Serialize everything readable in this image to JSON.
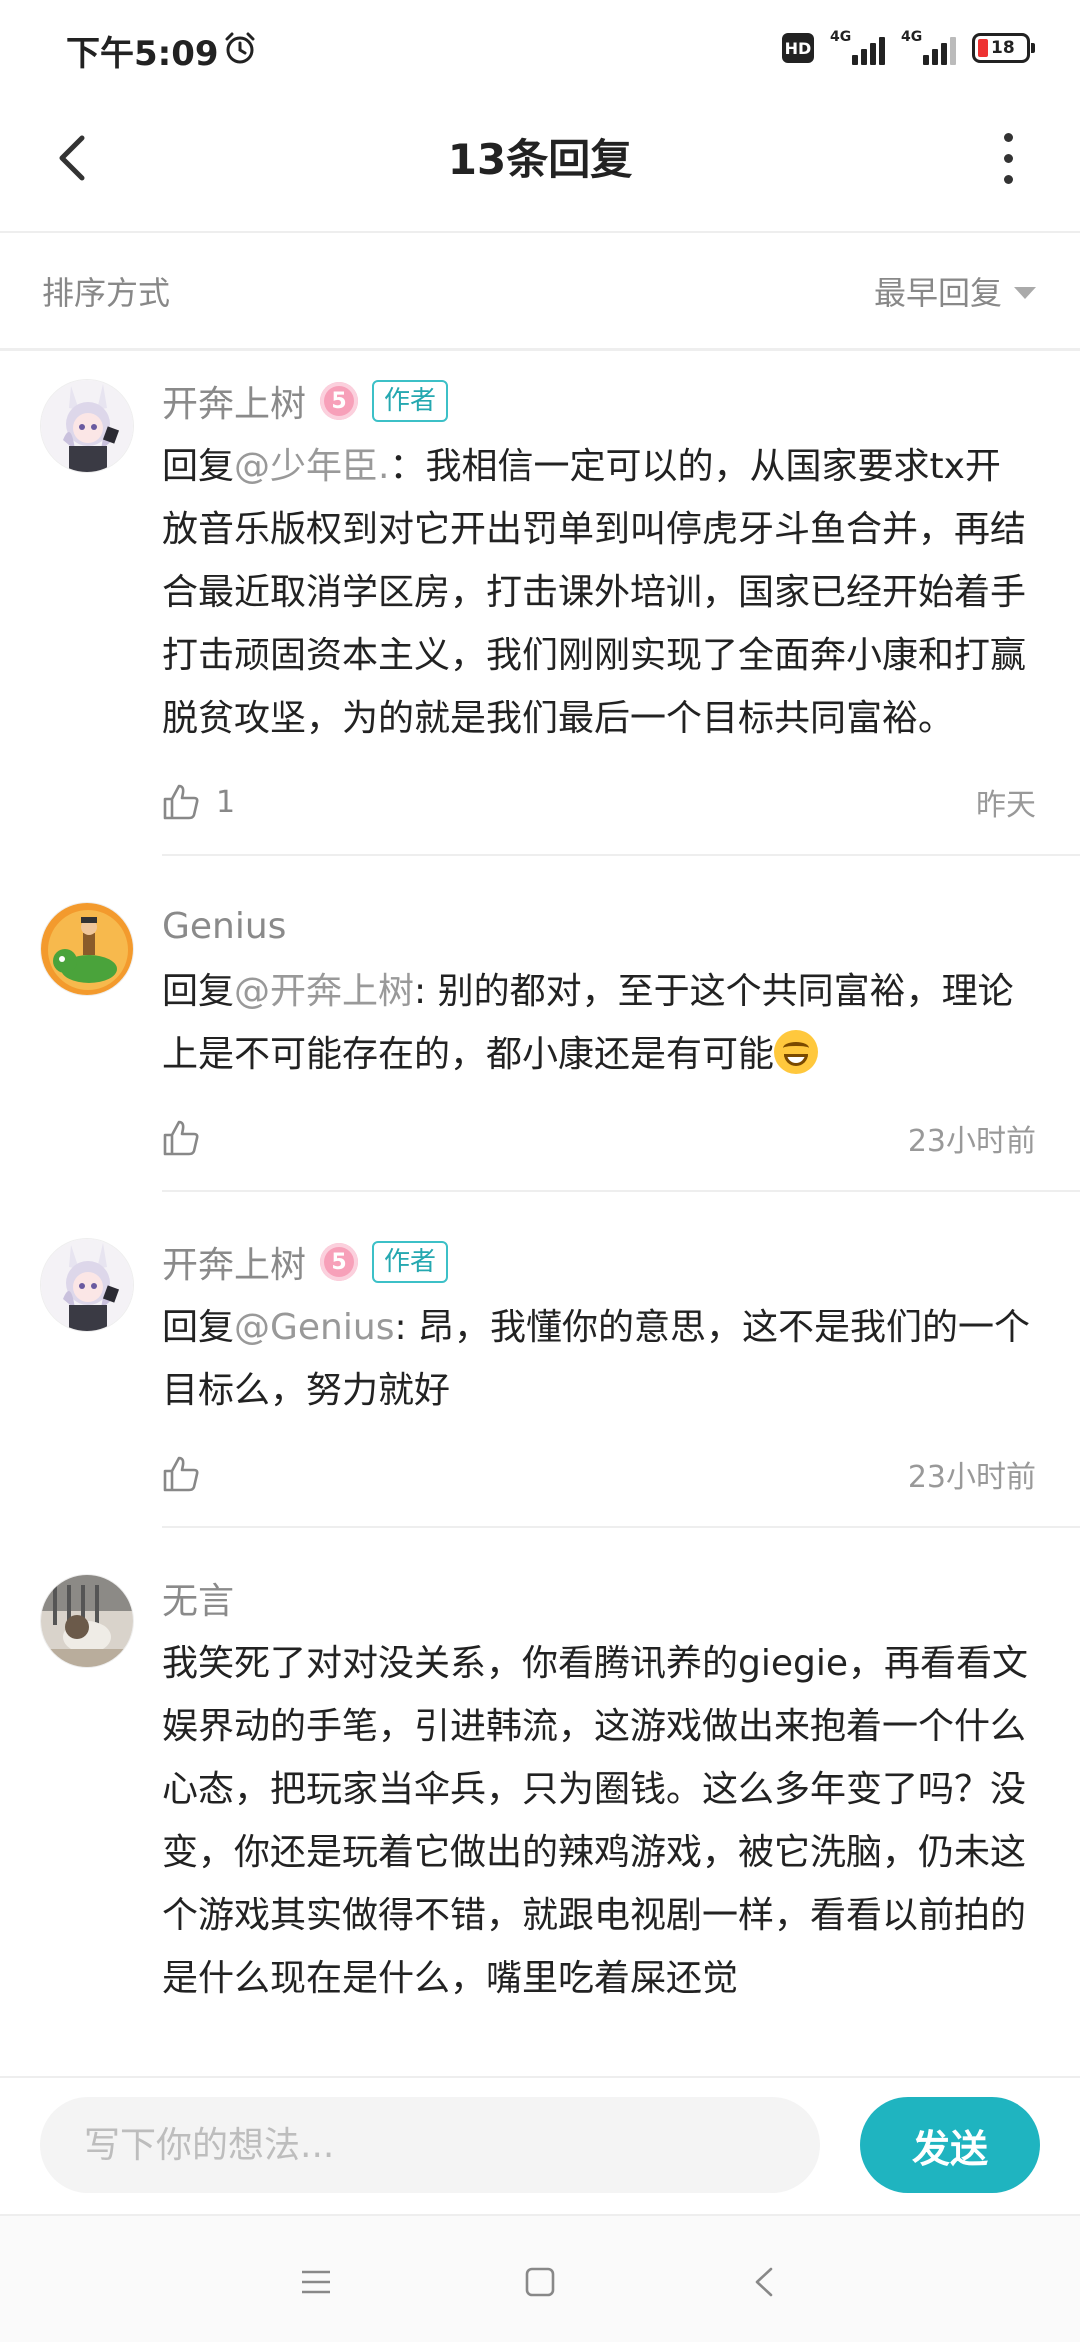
{
  "status_bar": {
    "time": "下午5:09",
    "hd": "HD",
    "network1": "4G",
    "network2": "4G",
    "battery": "18",
    "icons": [
      "alarm-icon",
      "hd-icon",
      "signal-icon",
      "signal-icon",
      "battery-icon"
    ]
  },
  "header": {
    "title": "13条回复",
    "back_icon": "chevron-left-icon",
    "more_icon": "more-vertical-icon"
  },
  "sort": {
    "label": "排序方式",
    "value": "最早回复"
  },
  "replies": [
    {
      "name": "开奔上树",
      "level": "5",
      "author_tag": "作者",
      "prefix": "回复",
      "mention": "@少年臣.",
      "text": "：我相信一定可以的，从国家要求tx开放音乐版权到对它开出罚单到叫停虎牙斗鱼合并，再结合最近取消学区房，打击课外培训，国家已经开始着手打击顽固资本主义，我们刚刚实现了全面奔小康和打赢脱贫攻坚，为的就是我们最后一个目标共同富裕。",
      "likes": "1",
      "time": "昨天"
    },
    {
      "name": "Genius",
      "prefix": "回复",
      "mention": "@开奔上树",
      "text": ": 别的都对，至于这个共同富裕，理论上是不可能存在的，都小康还是有可能",
      "likes": "",
      "time": "23小时前"
    },
    {
      "name": "开奔上树",
      "level": "5",
      "author_tag": "作者",
      "prefix": "回复",
      "mention": "@Genius",
      "text": ": 昂，我懂你的意思，这不是我们的一个目标么，努力就好",
      "likes": "",
      "time": "23小时前"
    },
    {
      "name": "无言",
      "text": "我笑死了对对没关系，你看腾讯养的giegie，再看看文娱界动的手笔，引进韩流，这游戏做出来抱着一个什么心态，把玩家当伞兵，只为圈钱。这么多年变了吗？没变，你还是玩着它做出的辣鸡游戏，被它洗脑，仍未这个游戏其实做得不错，就跟电视剧一样，看看以前拍的是什么现在是什么，嘴里吃着屎还觉"
    }
  ],
  "composer": {
    "placeholder": "写下你的想法...",
    "send_label": "发送"
  },
  "navbar": {
    "icons": [
      "menu-icon",
      "home-square-icon",
      "back-triangle-icon"
    ]
  }
}
